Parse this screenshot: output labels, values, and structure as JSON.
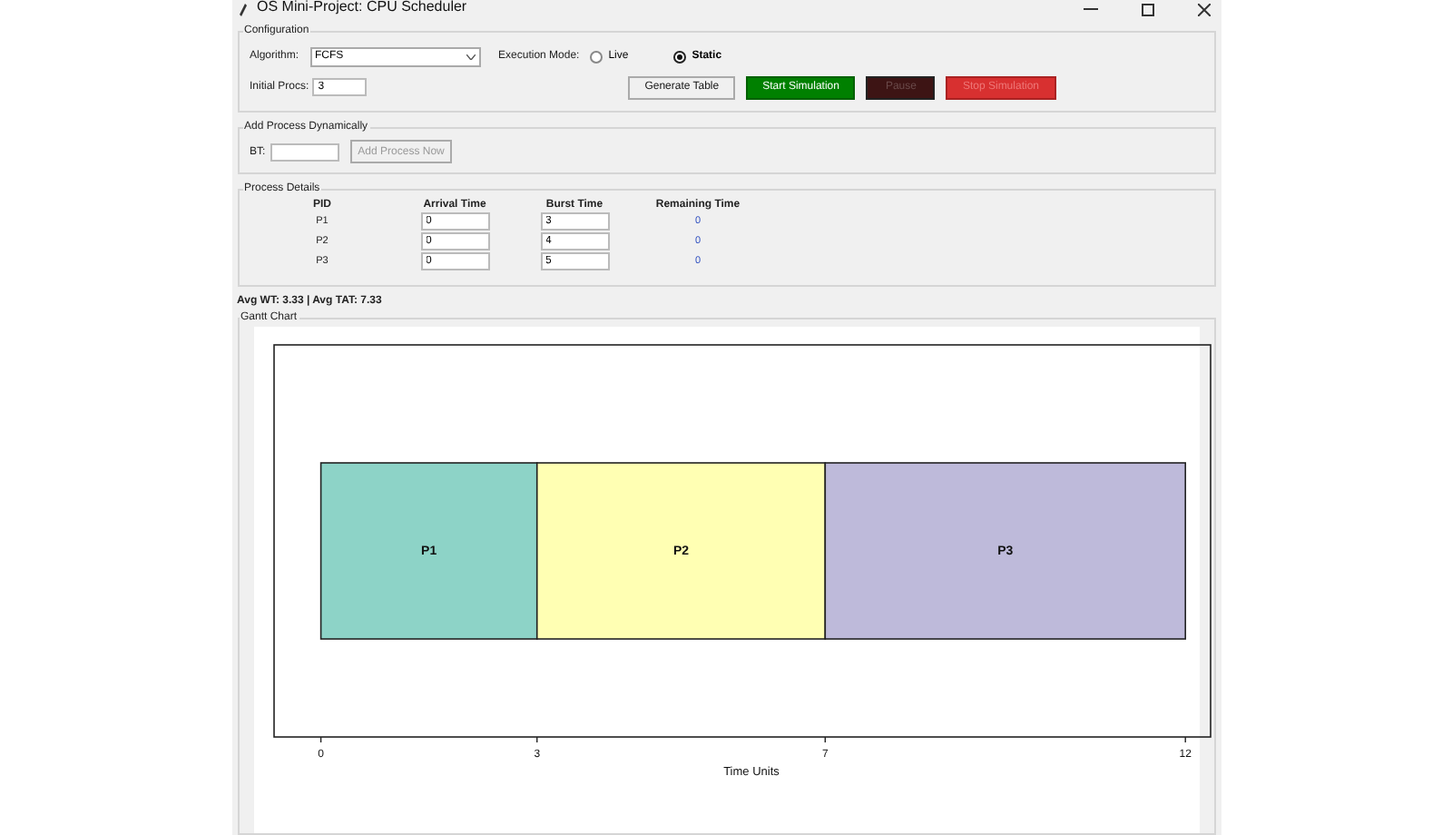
{
  "window": {
    "title": "OS Mini-Project: CPU Scheduler"
  },
  "configuration": {
    "title": "Configuration",
    "algorithm_label": "Algorithm:",
    "algorithm": "FCFS",
    "mode_label": "Execution Mode:",
    "modes": [
      {
        "label": "Live",
        "selected": false
      },
      {
        "label": "Static",
        "selected": true
      }
    ],
    "initial_procs_label": "Initial Procs:",
    "initial_procs": "3",
    "buttons": [
      {
        "label": "Generate Table",
        "kind": "plain",
        "disabled": false
      },
      {
        "label": "Start Simulation",
        "kind": "start",
        "disabled": false
      },
      {
        "label": "Pause",
        "kind": "pause",
        "disabled": true
      },
      {
        "label": "Stop Simulation",
        "kind": "stop",
        "disabled": true
      }
    ]
  },
  "add_process": {
    "title": "Add Process Dynamically",
    "bt_label": "BT:",
    "button": {
      "label": "Add Process Now",
      "disabled": true
    }
  },
  "process_details": {
    "title": "Process Details",
    "columns": [
      "PID",
      "Arrival Time",
      "Burst Time",
      "Remaining Time"
    ],
    "rows": [
      {
        "pid": "P1",
        "arrival": "0",
        "burst": "3",
        "remaining": "0"
      },
      {
        "pid": "P2",
        "arrival": "0",
        "burst": "4",
        "remaining": "0"
      },
      {
        "pid": "P3",
        "arrival": "0",
        "burst": "5",
        "remaining": "0"
      }
    ]
  },
  "averages": "Avg WT: 3.33 | Avg TAT: 7.33",
  "gantt": {
    "title": "Gantt Chart",
    "chart_data": {
      "type": "bar",
      "orientation": "horizontal",
      "stacked": true,
      "xlabel": "Time Units",
      "xlim": [
        -0.65,
        12.35
      ],
      "xticks": [
        0,
        3,
        7,
        12
      ],
      "series": [
        {
          "name": "P1",
          "color": "#8dd3c7",
          "values": [
            3
          ]
        },
        {
          "name": "P2",
          "color": "#ffffb3",
          "values": [
            4
          ]
        },
        {
          "name": "P3",
          "color": "#bebada",
          "values": [
            5
          ]
        }
      ]
    }
  }
}
